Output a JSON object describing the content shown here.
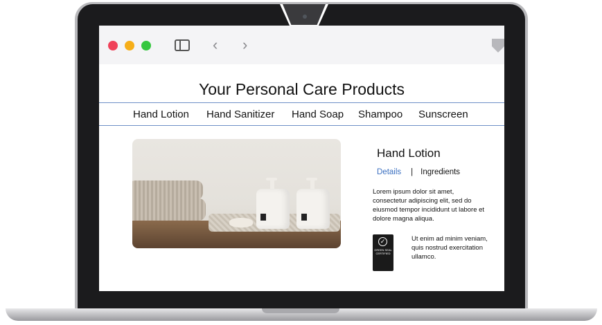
{
  "browser": {
    "back_icon": "‹",
    "forward_icon": "›"
  },
  "site": {
    "title": "Your Personal Care Products",
    "nav": [
      "Hand Lotion",
      "Hand Sanitizer",
      "Hand Soap",
      "Shampoo",
      "Sunscreen"
    ]
  },
  "product": {
    "title": "Hand Lotion",
    "tabs": {
      "active": "Details",
      "separator": "|",
      "other": "Ingredients"
    },
    "description": "Lorem ipsum dolor sit amet, consectetur adipiscing elit, sed do eiusmod tempor incididunt ut labore et dolore magna aliqua.",
    "cert_text": "Ut enim ad minim veniam, quis nostrud exercitation ullamco.",
    "seal_text": "GREEN SEAL CERTIFIED"
  },
  "colors": {
    "accent": "#3a6fc0",
    "nav_border": "#6d8fc7",
    "traffic_red": "#f0425a",
    "traffic_yellow": "#f6ae19",
    "traffic_green": "#35c73f"
  }
}
